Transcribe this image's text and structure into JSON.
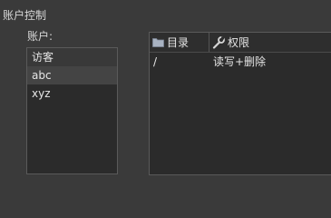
{
  "group_title": "账户控制",
  "accounts": {
    "label": "账户:",
    "items": [
      {
        "label": "访客"
      },
      {
        "label": "abc"
      },
      {
        "label": "xyz"
      }
    ]
  },
  "permissions": {
    "columns": [
      {
        "label": "目录",
        "icon": "folder-icon"
      },
      {
        "label": "权限",
        "icon": "wrench-icon"
      }
    ],
    "rows": [
      {
        "directory": "/",
        "permission": "读写+删除"
      }
    ]
  }
}
